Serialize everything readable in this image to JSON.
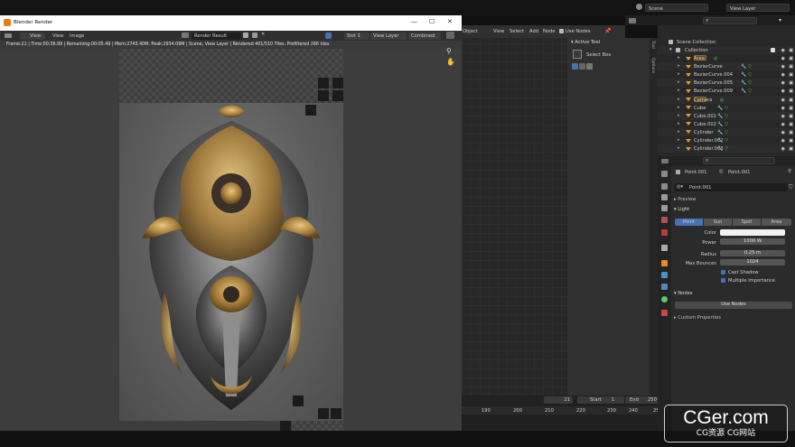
{
  "blender_header": {
    "scene_label": "Scene",
    "view_layer_label": "View Layer"
  },
  "render_window": {
    "title": "Blender Render",
    "controls": {
      "minimize": "—",
      "maximize": "☐",
      "close": "✕"
    },
    "menu": {
      "view": "View",
      "view2": "View",
      "image": "Image",
      "image_name": "Render Result",
      "slot": "Slot 1",
      "layer": "View Layer",
      "pass": "Combined"
    },
    "info": "Frame:21 | Time:00:36.99 | Remaining:00:05.49 | Mem:2743.40M, Peak:2934.09M | Scene, View Layer | Rendered 401/510 Tiles, Prefiltered 266 tiles"
  },
  "node_editor": {
    "menu": {
      "object": "Object",
      "view": "View",
      "select": "Select",
      "add": "Add",
      "node": "Node",
      "use_nodes": "Use Nodes"
    },
    "active_tool": {
      "title": "Active Tool",
      "tool": "Select Box"
    },
    "side_tabs": [
      "Tool",
      "Options"
    ]
  },
  "timeline": {
    "frame": "21",
    "start_label": "Start",
    "start": "1",
    "end_label": "End",
    "end": "250",
    "ticks": [
      "190",
      "200",
      "210",
      "220",
      "230",
      "240",
      "250"
    ]
  },
  "outliner": {
    "search_placeholder": "",
    "scene_collection": "Scene Collection",
    "collection": "Collection",
    "items": [
      {
        "label": "Area",
        "kind": "light"
      },
      {
        "label": "BezierCurve",
        "kind": "curve"
      },
      {
        "label": "BezierCurve.004",
        "kind": "curve"
      },
      {
        "label": "BezierCurve.005",
        "kind": "curve"
      },
      {
        "label": "BezierCurve.009",
        "kind": "curve"
      },
      {
        "label": "Camera",
        "kind": "camera"
      },
      {
        "label": "Cube",
        "kind": "mesh"
      },
      {
        "label": "Cube.001",
        "kind": "mesh"
      },
      {
        "label": "Cube.002",
        "kind": "mesh"
      },
      {
        "label": "Cylinder",
        "kind": "mesh"
      },
      {
        "label": "Cylinder.002",
        "kind": "mesh"
      },
      {
        "label": "Cylinder.003",
        "kind": "mesh"
      }
    ]
  },
  "properties": {
    "breadcrumb": {
      "object": "Point.001",
      "data": "Point.001"
    },
    "datablock": "Point.001",
    "sections": {
      "preview": "Preview",
      "light": "Light",
      "nodes": "Nodes",
      "custom": "Custom Properties"
    },
    "light_types": [
      "Point",
      "Sun",
      "Spot",
      "Area"
    ],
    "active_light_type": "Point",
    "fields": {
      "color_label": "Color",
      "color_value": "#f2f2f2",
      "power_label": "Power",
      "power": "1000 W",
      "radius_label": "Radius",
      "radius": "0.25 m",
      "max_bounces_label": "Max Bounces",
      "max_bounces": "1024"
    },
    "checkboxes": [
      {
        "label": "Cast Shadow",
        "checked": true
      },
      {
        "label": "Multiple Importance",
        "checked": true
      }
    ],
    "use_nodes_button": "Use Nodes"
  },
  "watermark": {
    "main": "CGer.com",
    "sub": "CG资源 CG网站"
  },
  "colors": {
    "accent": "#4772b3",
    "light_orange": "#e59a33",
    "green": "#61c85f",
    "blender_orange": "#e87d0d"
  }
}
